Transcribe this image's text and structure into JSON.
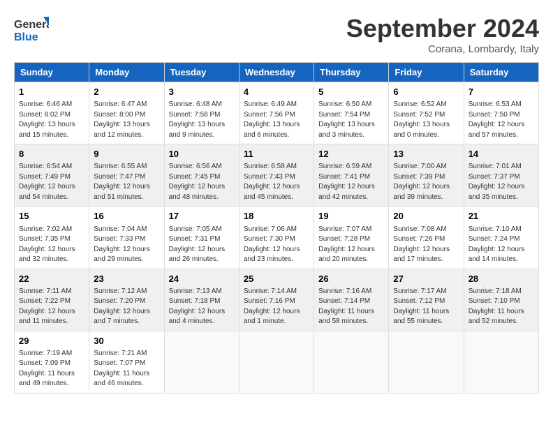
{
  "logo": {
    "general": "General",
    "blue": "Blue"
  },
  "title": "September 2024",
  "location": "Corana, Lombardy, Italy",
  "headers": [
    "Sunday",
    "Monday",
    "Tuesday",
    "Wednesday",
    "Thursday",
    "Friday",
    "Saturday"
  ],
  "weeks": [
    [
      {
        "day": "1",
        "info": "Sunrise: 6:46 AM\nSunset: 8:02 PM\nDaylight: 13 hours\nand 15 minutes."
      },
      {
        "day": "2",
        "info": "Sunrise: 6:47 AM\nSunset: 8:00 PM\nDaylight: 13 hours\nand 12 minutes."
      },
      {
        "day": "3",
        "info": "Sunrise: 6:48 AM\nSunset: 7:58 PM\nDaylight: 13 hours\nand 9 minutes."
      },
      {
        "day": "4",
        "info": "Sunrise: 6:49 AM\nSunset: 7:56 PM\nDaylight: 13 hours\nand 6 minutes."
      },
      {
        "day": "5",
        "info": "Sunrise: 6:50 AM\nSunset: 7:54 PM\nDaylight: 13 hours\nand 3 minutes."
      },
      {
        "day": "6",
        "info": "Sunrise: 6:52 AM\nSunset: 7:52 PM\nDaylight: 13 hours\nand 0 minutes."
      },
      {
        "day": "7",
        "info": "Sunrise: 6:53 AM\nSunset: 7:50 PM\nDaylight: 12 hours\nand 57 minutes."
      }
    ],
    [
      {
        "day": "8",
        "info": "Sunrise: 6:54 AM\nSunset: 7:49 PM\nDaylight: 12 hours\nand 54 minutes."
      },
      {
        "day": "9",
        "info": "Sunrise: 6:55 AM\nSunset: 7:47 PM\nDaylight: 12 hours\nand 51 minutes."
      },
      {
        "day": "10",
        "info": "Sunrise: 6:56 AM\nSunset: 7:45 PM\nDaylight: 12 hours\nand 48 minutes."
      },
      {
        "day": "11",
        "info": "Sunrise: 6:58 AM\nSunset: 7:43 PM\nDaylight: 12 hours\nand 45 minutes."
      },
      {
        "day": "12",
        "info": "Sunrise: 6:59 AM\nSunset: 7:41 PM\nDaylight: 12 hours\nand 42 minutes."
      },
      {
        "day": "13",
        "info": "Sunrise: 7:00 AM\nSunset: 7:39 PM\nDaylight: 12 hours\nand 39 minutes."
      },
      {
        "day": "14",
        "info": "Sunrise: 7:01 AM\nSunset: 7:37 PM\nDaylight: 12 hours\nand 35 minutes."
      }
    ],
    [
      {
        "day": "15",
        "info": "Sunrise: 7:02 AM\nSunset: 7:35 PM\nDaylight: 12 hours\nand 32 minutes."
      },
      {
        "day": "16",
        "info": "Sunrise: 7:04 AM\nSunset: 7:33 PM\nDaylight: 12 hours\nand 29 minutes."
      },
      {
        "day": "17",
        "info": "Sunrise: 7:05 AM\nSunset: 7:31 PM\nDaylight: 12 hours\nand 26 minutes."
      },
      {
        "day": "18",
        "info": "Sunrise: 7:06 AM\nSunset: 7:30 PM\nDaylight: 12 hours\nand 23 minutes."
      },
      {
        "day": "19",
        "info": "Sunrise: 7:07 AM\nSunset: 7:28 PM\nDaylight: 12 hours\nand 20 minutes."
      },
      {
        "day": "20",
        "info": "Sunrise: 7:08 AM\nSunset: 7:26 PM\nDaylight: 12 hours\nand 17 minutes."
      },
      {
        "day": "21",
        "info": "Sunrise: 7:10 AM\nSunset: 7:24 PM\nDaylight: 12 hours\nand 14 minutes."
      }
    ],
    [
      {
        "day": "22",
        "info": "Sunrise: 7:11 AM\nSunset: 7:22 PM\nDaylight: 12 hours\nand 11 minutes."
      },
      {
        "day": "23",
        "info": "Sunrise: 7:12 AM\nSunset: 7:20 PM\nDaylight: 12 hours\nand 7 minutes."
      },
      {
        "day": "24",
        "info": "Sunrise: 7:13 AM\nSunset: 7:18 PM\nDaylight: 12 hours\nand 4 minutes."
      },
      {
        "day": "25",
        "info": "Sunrise: 7:14 AM\nSunset: 7:16 PM\nDaylight: 12 hours\nand 1 minute."
      },
      {
        "day": "26",
        "info": "Sunrise: 7:16 AM\nSunset: 7:14 PM\nDaylight: 11 hours\nand 58 minutes."
      },
      {
        "day": "27",
        "info": "Sunrise: 7:17 AM\nSunset: 7:12 PM\nDaylight: 11 hours\nand 55 minutes."
      },
      {
        "day": "28",
        "info": "Sunrise: 7:18 AM\nSunset: 7:10 PM\nDaylight: 11 hours\nand 52 minutes."
      }
    ],
    [
      {
        "day": "29",
        "info": "Sunrise: 7:19 AM\nSunset: 7:09 PM\nDaylight: 11 hours\nand 49 minutes."
      },
      {
        "day": "30",
        "info": "Sunrise: 7:21 AM\nSunset: 7:07 PM\nDaylight: 11 hours\nand 46 minutes."
      },
      {
        "day": "",
        "info": ""
      },
      {
        "day": "",
        "info": ""
      },
      {
        "day": "",
        "info": ""
      },
      {
        "day": "",
        "info": ""
      },
      {
        "day": "",
        "info": ""
      }
    ]
  ]
}
